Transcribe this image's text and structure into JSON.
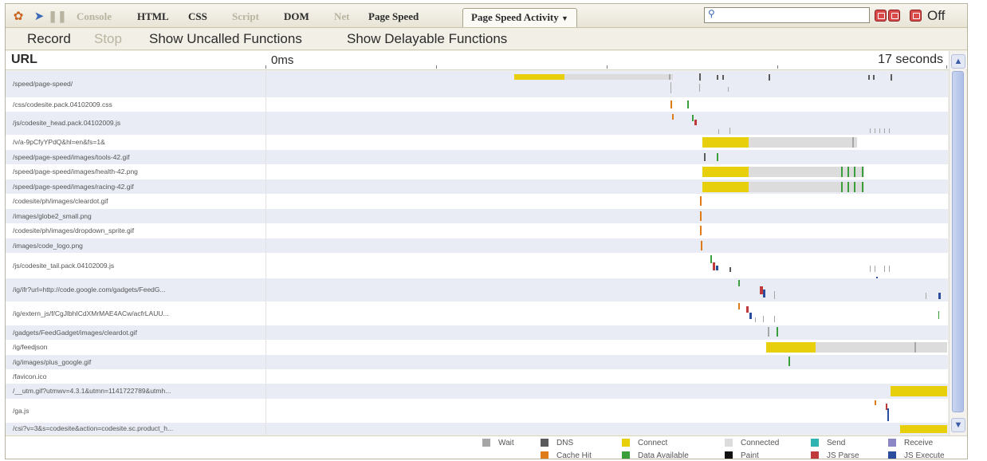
{
  "toolbar": {
    "tabs": [
      {
        "label": "Console",
        "enabled": false
      },
      {
        "label": "HTML",
        "enabled": true
      },
      {
        "label": "CSS",
        "enabled": true
      },
      {
        "label": "Script",
        "enabled": false
      },
      {
        "label": "DOM",
        "enabled": true
      },
      {
        "label": "Net",
        "enabled": false
      },
      {
        "label": "Page Speed",
        "enabled": true
      },
      {
        "label": "Page Speed Activity",
        "enabled": true,
        "active": true,
        "dropdown": true
      }
    ],
    "search_value": "",
    "off_label": "Off",
    "icons": [
      "firebug-bug-icon",
      "inspect-cursor-icon",
      "pause-icon",
      "minimize-window-icon",
      "detach-window-icon",
      "close-window-icon",
      "search-icon",
      "chevron-down-icon"
    ]
  },
  "subtoolbar": {
    "record_label": "Record",
    "stop_label": "Stop",
    "uncalled_label": "Show Uncalled Functions",
    "delayable_label": "Show Delayable Functions"
  },
  "timeline": {
    "url_header": "URL",
    "start_label": "0ms",
    "end_label": "17 seconds"
  },
  "rows": [
    {
      "url": "/speed/page-speed/"
    },
    {
      "url": "/css/codesite.pack.04102009.css"
    },
    {
      "url": "/js/codesite_head.pack.04102009.js"
    },
    {
      "url": "/v/a-9pCfyYPdQ&hl=en&fs=1&"
    },
    {
      "url": "/speed/page-speed/images/tools-42.gif"
    },
    {
      "url": "/speed/page-speed/images/health-42.png"
    },
    {
      "url": "/speed/page-speed/images/racing-42.gif"
    },
    {
      "url": "/codesite/ph/images/cleardot.gif"
    },
    {
      "url": "/images/globe2_small.png"
    },
    {
      "url": "/codesite/ph/images/dropdown_sprite.gif"
    },
    {
      "url": "/images/code_logo.png"
    },
    {
      "url": "/js/codesite_tail.pack.04102009.js"
    },
    {
      "url": "/ig/ifr?url=http://code.google.com/gadgets/FeedG..."
    },
    {
      "url": "/ig/extern_js/f/CgJlbhICdXMrMAE4ACw/acfrLAUU..."
    },
    {
      "url": "/gadgets/FeedGadget/images/cleardot.gif"
    },
    {
      "url": "/ig/feedjson"
    },
    {
      "url": "/ig/images/plus_google.gif"
    },
    {
      "url": "/favicon.ico"
    },
    {
      "url": "/__utm.gif?utmwv=4.3.1&utmn=1141722789&utmh..."
    },
    {
      "url": "/ga.js"
    },
    {
      "url": "/csi?v=3&s=codesite&action=codesite.sc.product_h..."
    }
  ],
  "legend": [
    {
      "label": "Wait",
      "color": "#a6a6a6"
    },
    {
      "label": "DNS",
      "color": "#5a5a5a"
    },
    {
      "label": "Connect",
      "color": "#e8cf0b"
    },
    {
      "label": "Connected",
      "color": "#dcdcdc"
    },
    {
      "label": "Send",
      "color": "#2fb3b3"
    },
    {
      "label": "Receive",
      "color": "#8c86c4"
    },
    {
      "label": "Cache Hit",
      "color": "#e07b1a"
    },
    {
      "label": "Data Available",
      "color": "#3a9e3a"
    },
    {
      "label": "Paint",
      "color": "#111111"
    },
    {
      "label": "JS Parse",
      "color": "#c0393b"
    },
    {
      "label": "JS Execute",
      "color": "#2b4d9e"
    }
  ]
}
